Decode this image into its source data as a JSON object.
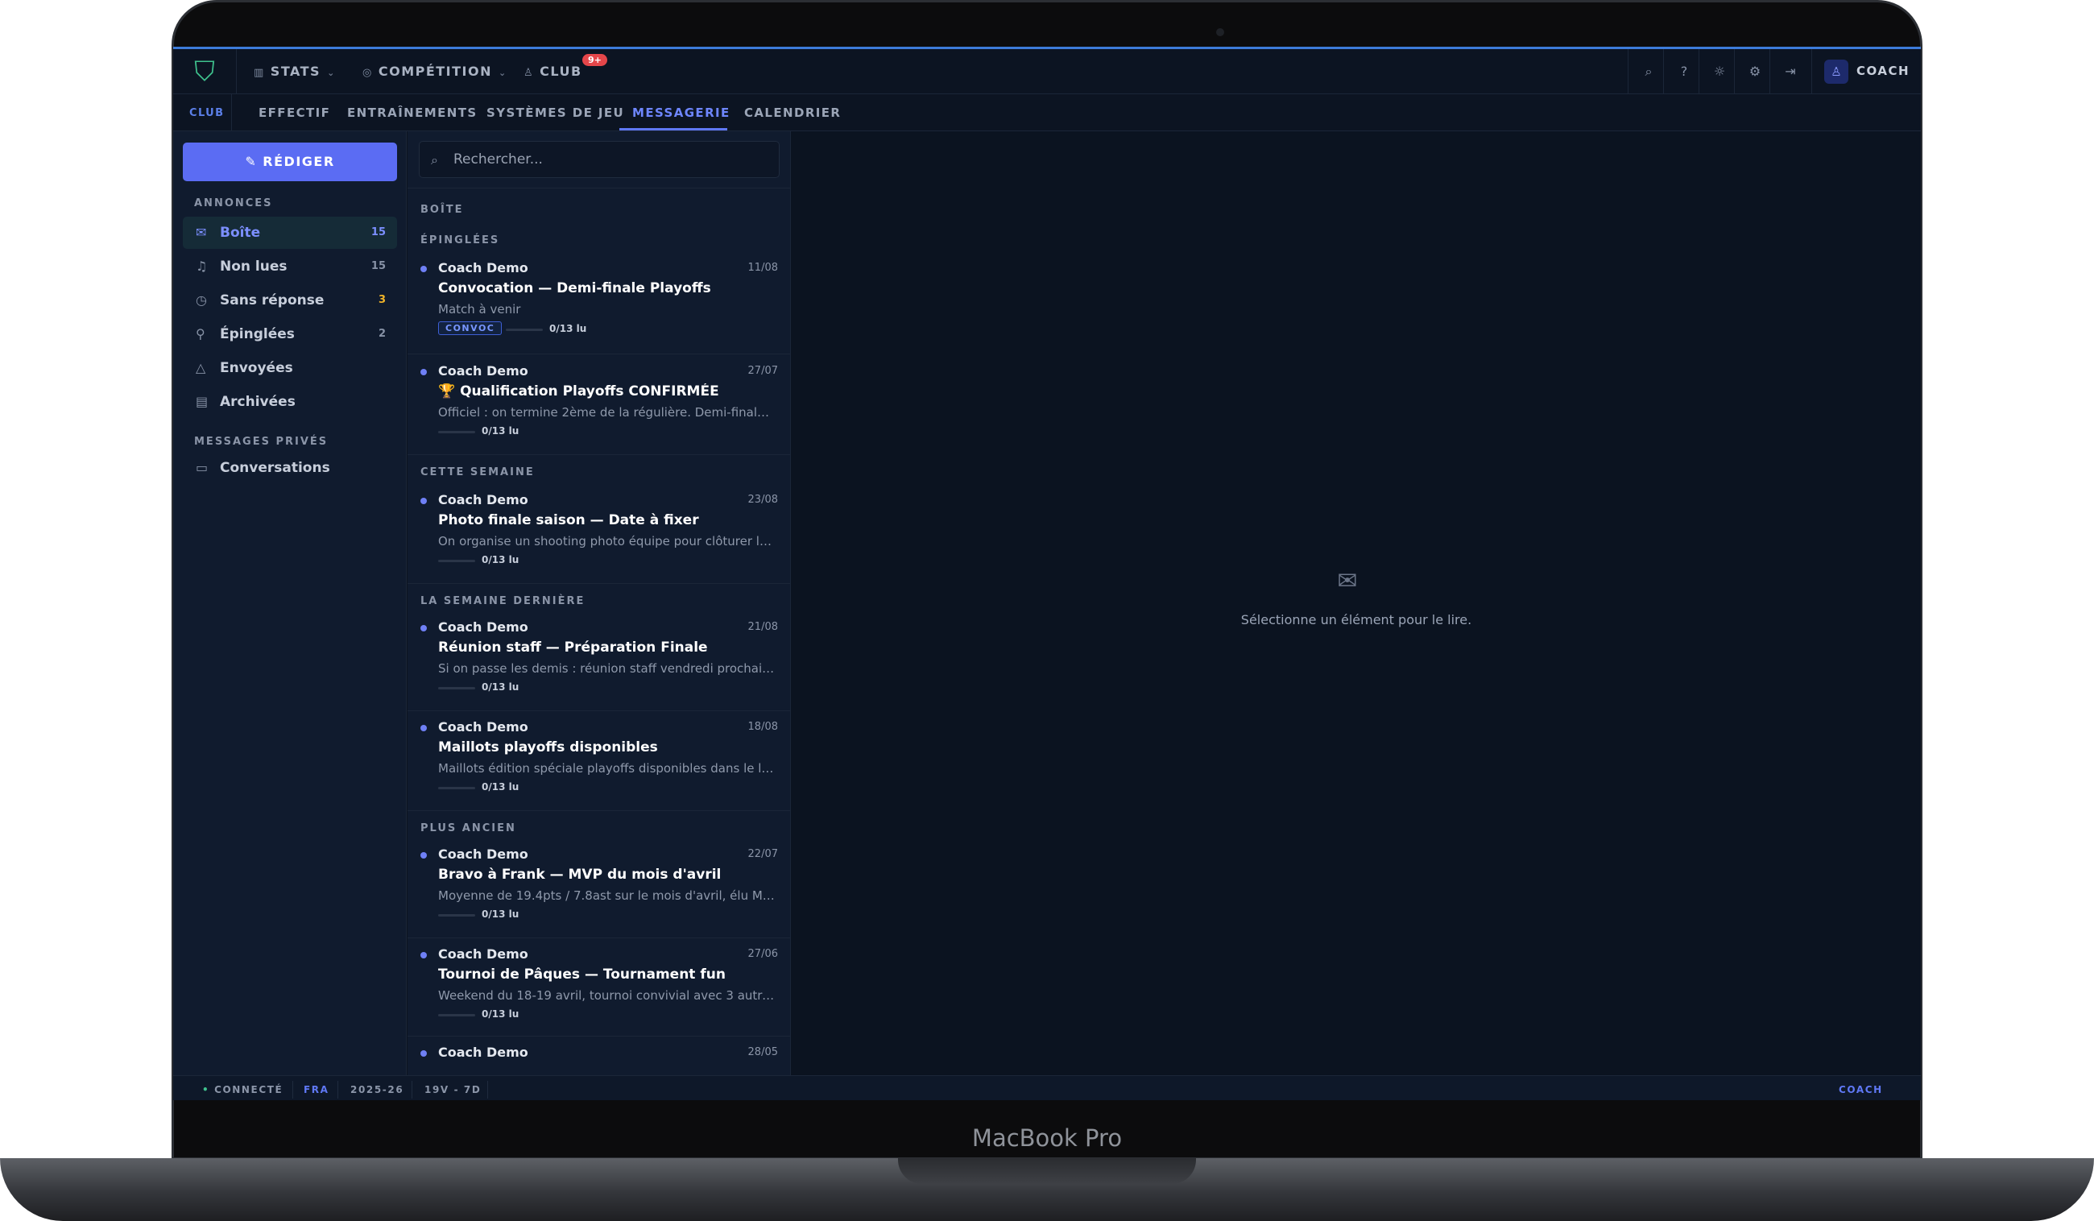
{
  "device": {
    "brand": "MacBook Pro"
  },
  "topbar": {
    "nav": [
      {
        "label": "STATS",
        "icon": "bar-chart-icon"
      },
      {
        "label": "COMPÉTITION",
        "icon": "target-icon"
      },
      {
        "label": "CLUB",
        "icon": "users-icon",
        "badge": "9+"
      }
    ],
    "user_label": "COACH"
  },
  "subnav": {
    "section": "CLUB",
    "tabs": [
      "EFFECTIF",
      "ENTRAÎNEMENTS",
      "SYSTÈMES DE JEU",
      "MESSAGERIE",
      "CALENDRIER"
    ],
    "active": "MESSAGERIE"
  },
  "sidebar": {
    "compose_label": "RÉDIGER",
    "announcements_title": "ANNONCES",
    "items": [
      {
        "label": "Boîte",
        "count": "15",
        "icon": "mail-icon"
      },
      {
        "label": "Non lues",
        "count": "15",
        "icon": "bell-icon"
      },
      {
        "label": "Sans réponse",
        "count": "3",
        "icon": "clock-icon"
      },
      {
        "label": "Épinglées",
        "count": "2",
        "icon": "pin-icon"
      },
      {
        "label": "Envoyées",
        "count": "",
        "icon": "send-icon"
      },
      {
        "label": "Archivées",
        "count": "",
        "icon": "archive-icon"
      }
    ],
    "private_title": "MESSAGES PRIVÉS",
    "private_items": [
      {
        "label": "Conversations",
        "icon": "chat-icon"
      }
    ]
  },
  "list": {
    "search_placeholder": "Rechercher...",
    "box_title": "BOÎTE",
    "groups": {
      "pinned": "ÉPINGLÉES",
      "this_week": "CETTE SEMAINE",
      "last_week": "LA SEMAINE DERNIÈRE",
      "older": "PLUS ANCIEN"
    },
    "messages": [
      {
        "from": "Coach Demo",
        "date": "11/08",
        "subject": "Convocation — Demi-finale Playoffs",
        "preview": "Match à venir",
        "tag": "CONVOC",
        "read": "0/13 lu"
      },
      {
        "from": "Coach Demo",
        "date": "27/07",
        "subject": "🏆 Qualification Playoffs CONFIRMÉE",
        "preview": "Officiel : on termine 2ème de la régulière. Demi-finale v...",
        "read": "0/13 lu"
      },
      {
        "from": "Coach Demo",
        "date": "23/08",
        "subject": "Photo finale saison — Date à fixer",
        "preview": "On organise un shooting photo équipe pour clôturer la ...",
        "read": "0/13 lu"
      },
      {
        "from": "Coach Demo",
        "date": "21/08",
        "subject": "Réunion staff — Préparation Finale",
        "preview": "Si on passe les demis : réunion staff vendredi prochain ...",
        "read": "0/13 lu"
      },
      {
        "from": "Coach Demo",
        "date": "18/08",
        "subject": "Maillots playoffs disponibles",
        "preview": "Maillots édition spéciale playoffs disponibles dans le lo...",
        "read": "0/13 lu"
      },
      {
        "from": "Coach Demo",
        "date": "22/07",
        "subject": "Bravo à Frank — MVP du mois d'avril",
        "preview": "Moyenne de 19.4pts / 7.8ast sur le mois d'avril, élu MV...",
        "read": "0/13 lu"
      },
      {
        "from": "Coach Demo",
        "date": "27/06",
        "subject": "Tournoi de Pâques — Tournament fun",
        "preview": "Weekend du 18-19 avril, tournoi convivial avec 3 autres...",
        "read": "0/13 lu"
      },
      {
        "from": "Coach Demo",
        "date": "28/05",
        "subject": "",
        "preview": "",
        "read": ""
      }
    ]
  },
  "reader": {
    "empty_text": "Sélectionne un élément pour le lire."
  },
  "statusbar": {
    "connection": "CONNECTÉ",
    "team": "FRA",
    "season": "2025-26",
    "record": "19V - 7D",
    "role": "COACH"
  }
}
